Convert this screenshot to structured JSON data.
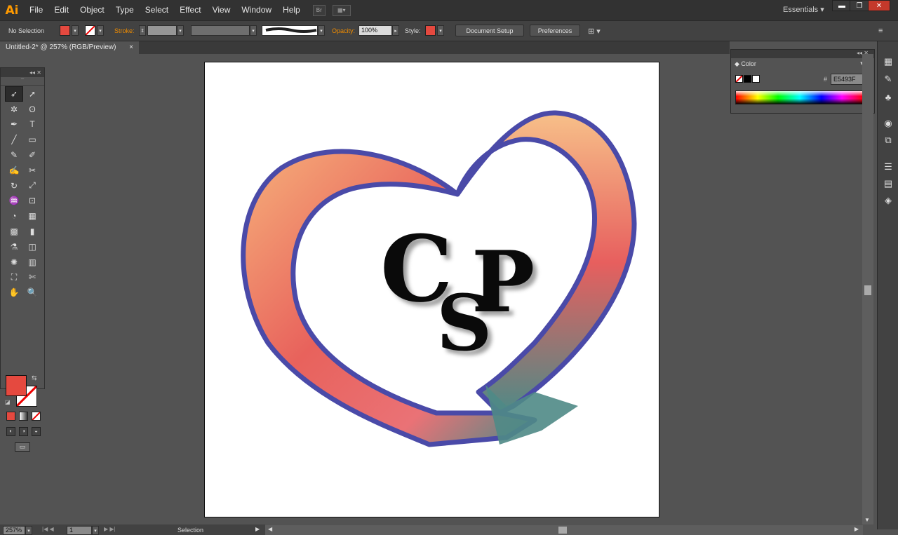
{
  "app": {
    "logo": "Ai",
    "workspace": "Essentials ▾"
  },
  "menu": [
    "File",
    "Edit",
    "Object",
    "Type",
    "Select",
    "Effect",
    "View",
    "Window",
    "Help"
  ],
  "menubar_buttons": {
    "bridge": "Br",
    "arrange": "▦▾"
  },
  "window_controls": {
    "minimize": "▬",
    "maximize": "❐",
    "close": "✕"
  },
  "control_bar": {
    "selection_status": "No Selection",
    "stroke_label": "Stroke:",
    "opacity_label": "Opacity:",
    "opacity_value": "100%",
    "style_label": "Style:",
    "document_setup": "Document Setup",
    "preferences": "Preferences",
    "fill_color": "#E5493F"
  },
  "document_tab": {
    "title": "Untitled-2* @ 257% (RGB/Preview)",
    "close": "×"
  },
  "tools_panel": {
    "collapse": "◂◂ ✕",
    "tools": [
      "selection",
      "direct-selection",
      "magic-wand",
      "lasso",
      "pen",
      "type",
      "line-segment",
      "rectangle",
      "paintbrush",
      "pencil",
      "blob-brush",
      "scissors",
      "rotate",
      "scale",
      "warp",
      "free-transform",
      "shape-builder",
      "graph",
      "mesh",
      "gradient",
      "eyedropper",
      "blend",
      "symbol-sprayer",
      "column-graph",
      "artboard",
      "slice",
      "hand",
      "zoom"
    ],
    "tool_glyphs": [
      "➶",
      "➚",
      "✲",
      "ʘ",
      "✒",
      "T",
      "╱",
      "▭",
      "✎",
      "✐",
      "✍",
      "✂",
      "↻",
      "⤢",
      "♒",
      "⊡",
      "◔",
      "▦",
      "▩",
      "▮",
      "⚗",
      "◫",
      "✺",
      "▥",
      "⛶",
      "✄",
      "✋",
      "🔍"
    ]
  },
  "color_panel": {
    "tab_label": "◆ Color",
    "hex_prefix": "#",
    "hex_value": "E5493F",
    "menu": "◂◂ ✕"
  },
  "artwork": {
    "letters": [
      "C",
      "S",
      "P"
    ],
    "heart_stroke_color": "#4a4aa8",
    "gradient_colors": [
      "#f2a070",
      "#e8605a",
      "#4f8a86"
    ]
  },
  "status_bar": {
    "zoom": "257%",
    "page": "1",
    "mode": "Selection"
  }
}
